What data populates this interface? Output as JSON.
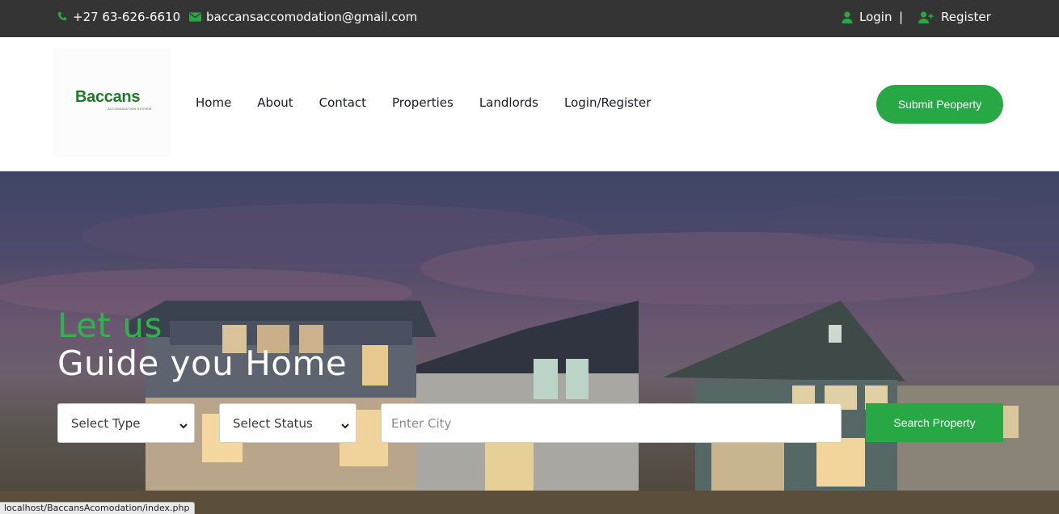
{
  "topbar": {
    "phone": "+27 63-626-6610",
    "email": "baccansaccomodation@gmail.com",
    "login": "Login",
    "separator": "|",
    "register": "Register"
  },
  "brand": {
    "name": "Baccans",
    "tagline": "ACCOMODATION SYSTEM"
  },
  "nav": {
    "items": [
      "Home",
      "About",
      "Contact",
      "Properties",
      "Landlords",
      "Login/Register"
    ]
  },
  "header": {
    "submit_label": "Submit Peoperty"
  },
  "hero": {
    "line1": "Let us",
    "line2": "Guide you Home",
    "type_select": "Select Type",
    "status_select": "Select Status",
    "city_placeholder": "Enter City",
    "search_label": "Search Property"
  },
  "status_bar": {
    "url": "localhost/BaccansAcomodation/index.php"
  },
  "colors": {
    "topbar_bg": "#343434",
    "accent_green": "#28a745",
    "headline_green": "#2fb44a"
  },
  "icons": {
    "phone": "phone-icon",
    "email": "envelope-icon",
    "login": "user-icon",
    "register": "user-plus-icon",
    "select": "chevron-down-icon"
  }
}
